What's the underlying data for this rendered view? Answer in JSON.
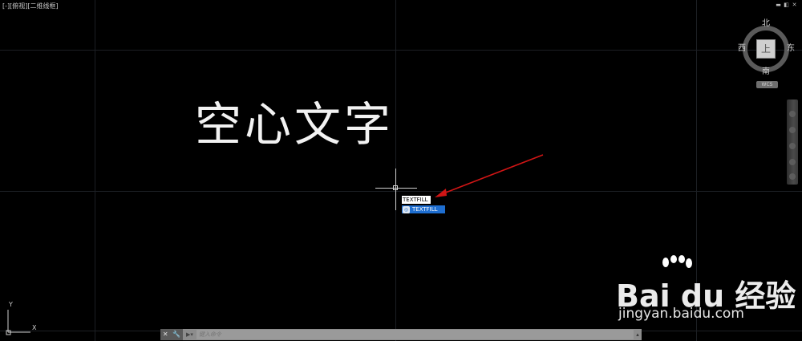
{
  "viewport": {
    "label": "[-][俯视][二维线框]"
  },
  "window_controls": [
    "▬",
    "◧",
    "✕"
  ],
  "drawing": {
    "text": "空心文字"
  },
  "viewcube": {
    "north": "北",
    "south": "南",
    "west": "西",
    "east": "东",
    "top_face": "上",
    "wcs": "WCS"
  },
  "dynamic_input": {
    "value": "TEXTFILL"
  },
  "autocomplete": {
    "items": [
      "TEXTFILL"
    ]
  },
  "ucs": {
    "x_label": "X",
    "y_label": "Y"
  },
  "command_line": {
    "close": "✕",
    "customize": "🔧",
    "prompt_icon": "▶▾",
    "placeholder": "键入命令",
    "scroll": "▴"
  },
  "watermark": {
    "brand": "Bai du 经验",
    "url": "jingyan.baidu.com"
  }
}
